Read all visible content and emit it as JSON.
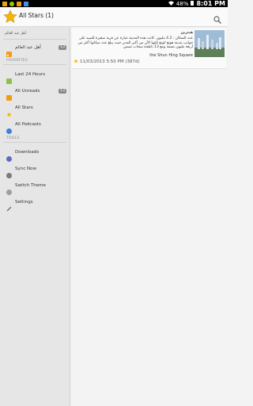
{
  "status": {
    "battery": "48%",
    "time": "8:01 PM"
  },
  "actionbar": {
    "title": "All Stars (1)"
  },
  "sidebar": {
    "feed_top": "أهل عبد العالم",
    "feed_item": {
      "label": "أهل عبد العالم",
      "count": "13"
    },
    "favorites_header": "FAVORITES",
    "favorites": [
      {
        "label": "Last 24 Hours",
        "icon": "rss-feed-icon"
      },
      {
        "label": "All Unreads",
        "count": "13",
        "icon": "rss-feed-icon"
      },
      {
        "label": "All Stars",
        "icon": "star-icon"
      },
      {
        "label": "All Podcasts",
        "icon": "podcast-icon"
      }
    ],
    "tools_header": "TOOLS",
    "tools": [
      {
        "label": "Downloads",
        "icon": "download-icon"
      },
      {
        "label": "Sync Now",
        "icon": "sync-icon"
      },
      {
        "label": "Switch Theme",
        "icon": "theme-icon"
      },
      {
        "label": "Settings",
        "icon": "settings-icon"
      }
    ]
  },
  "article": {
    "source": "هيتزين",
    "body_ar": "عدد السكان : 4.2 مليون. كانت هذه المدينة عبارة عن قرية صغيرة للصيد على جوانب مدينة هونغ كونغ لكنها الآن من أكبر المدن حيث يبلغ عدد سكانها أكثر من أربعة مليون نسمة ومع 13 ناطحة سحاب تضمن",
    "body_en": "the Shun Hing Square",
    "date": "11/03/2013 5:50 PM (387d)"
  }
}
